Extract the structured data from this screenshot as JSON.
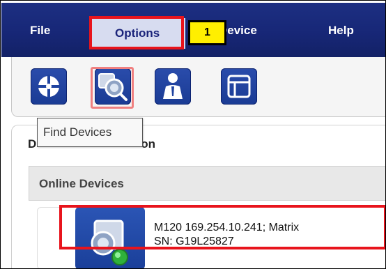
{
  "menu": {
    "file": "File",
    "options": "Options",
    "device": "Device",
    "help": "Help"
  },
  "step_badge": "1",
  "toolbar": {
    "buttons": [
      {
        "icon": "compass-icon"
      },
      {
        "icon": "find-devices-icon"
      },
      {
        "icon": "user-icon"
      },
      {
        "icon": "window-icon"
      }
    ]
  },
  "tooltip": "Find Devices",
  "section_title": "D",
  "section_title_tail": "on",
  "online_devices_header": "Online Devices",
  "device": {
    "line1": "M120 169.254.10.241; Matrix",
    "line2": "SN: G19L25827"
  },
  "colors": {
    "menubar": "#1a2a7d",
    "callout": "#e8141c",
    "badge": "#ffef00",
    "toolbar_button": "#1f43a0"
  }
}
